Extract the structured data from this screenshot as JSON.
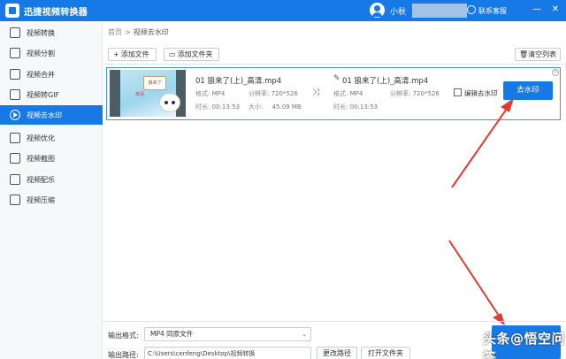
{
  "app": {
    "title": "迅捷视频转换器"
  },
  "header": {
    "username": "小秋",
    "support_label": "联系客服",
    "minimize": "—",
    "close": "✕"
  },
  "sidebar": {
    "items": [
      {
        "label": "视频转换",
        "icon": "video-convert-icon"
      },
      {
        "label": "视频分割",
        "icon": "video-split-icon"
      },
      {
        "label": "视频合并",
        "icon": "video-merge-icon"
      },
      {
        "label": "视频转GIF",
        "icon": "gif-icon"
      },
      {
        "label": "视频去水印",
        "icon": "play-icon",
        "active": true
      },
      {
        "label": "视频优化",
        "icon": "optimize-icon"
      },
      {
        "label": "视频截图",
        "icon": "screenshot-icon"
      },
      {
        "label": "视频配乐",
        "icon": "music-icon"
      },
      {
        "label": "视频压缩",
        "icon": "compress-icon"
      }
    ]
  },
  "breadcrumb": {
    "home": "首页",
    "separator": ">",
    "current": "视频去水印"
  },
  "toolbar": {
    "add_file": "添加文件",
    "add_folder": "添加文件夹",
    "clear_list": "清空列表"
  },
  "file_item": {
    "source": {
      "name": "01 狼来了(上)_高清.mp4",
      "format_label": "格式:",
      "format": "MP4",
      "resolution_label": "分辨率:",
      "resolution": "720*526",
      "duration_label": "时长:",
      "duration": "00:13:53",
      "size_label": "大小:",
      "size": "45.09 MB"
    },
    "output": {
      "name": "01 狼来了(上)_高清.mp4",
      "format_label": "格式:",
      "format": "MP4",
      "resolution_label": "分辨率:",
      "resolution": "720*526",
      "duration_label": "时长:",
      "duration": "00:13:53"
    },
    "edit_label": "编辑去水印",
    "remove_button": "去水印",
    "thumb_sign": "狼来了",
    "thumb_tag": "高清"
  },
  "bottom": {
    "format_label": "输出格式:",
    "format_value": "MP4 同原文件",
    "path_label": "输出路径:",
    "path_value": "C:\\Users\\cenfeng\\Desktop\\视频转换",
    "change_path": "更改路径",
    "open_folder": "打开文件夹"
  },
  "watermark": {
    "text": "头条@悟空问答"
  },
  "colors": {
    "accent": "#1679e6",
    "arrow": "#e23b32"
  }
}
